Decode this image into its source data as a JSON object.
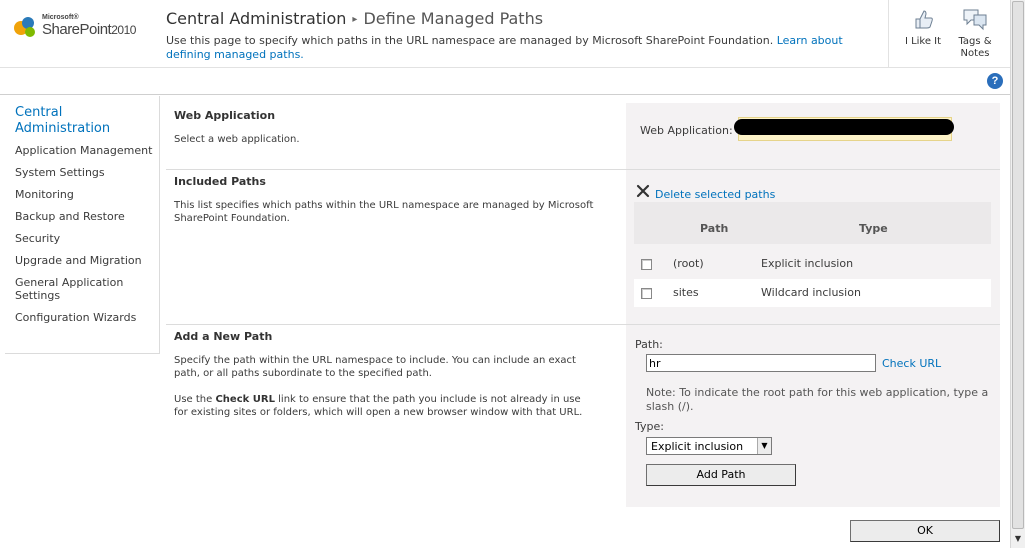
{
  "header": {
    "logo_microsoft": "Microsoft®",
    "logo_product": "SharePoint",
    "logo_year": "2010",
    "breadcrumb_root": "Central Administration",
    "breadcrumb_separator": "▸",
    "breadcrumb_current": "Define Managed Paths",
    "description": "Use this page to specify which paths in the URL namespace are managed by Microsoft SharePoint Foundation.",
    "learn_more_link": "Learn about defining managed paths.",
    "like_label": "I Like It",
    "tags_label_1": "Tags &",
    "tags_label_2": "Notes",
    "help_glyph": "?"
  },
  "leftnav": {
    "heading_1": "Central",
    "heading_2": "Administration",
    "items": [
      "Application Management",
      "System Settings",
      "Monitoring",
      "Backup and Restore",
      "Security",
      "Upgrade and Migration",
      "General Application",
      "Settings",
      "Configuration Wizards"
    ]
  },
  "sections": {
    "web_app": {
      "title": "Web Application",
      "description": "Select a web application.",
      "field_label": "Web Application:"
    },
    "included": {
      "title": "Included Paths",
      "description": "This list specifies which paths within the URL namespace are managed by Microsoft SharePoint Foundation.",
      "delete_link": "Delete selected paths",
      "col_path": "Path",
      "col_type": "Type",
      "rows": [
        {
          "path": "(root)",
          "type": "Explicit inclusion"
        },
        {
          "path": "sites",
          "type": "Wildcard inclusion"
        }
      ]
    },
    "add_path": {
      "title": "Add a New Path",
      "description_1": "Specify the path within the URL namespace to include. You can include an exact path, or all paths subordinate to the specified path.",
      "description_2_pre": "Use the ",
      "description_2_bold": "Check URL",
      "description_2_post": " link to ensure that the path you include is not already in use for existing sites or folders, which will open a new browser window with that URL.",
      "path_label": "Path:",
      "path_value": "hr",
      "check_url": "Check URL",
      "note": "Note: To indicate the root path for this web application, type a slash (/).",
      "type_label": "Type:",
      "type_value": "Explicit inclusion",
      "add_button": "Add Path"
    }
  },
  "footer": {
    "ok_button": "OK"
  },
  "colors": {
    "link": "#0072bc",
    "panel": "#f4f2f3",
    "highlight_field": "#fdf3c8"
  }
}
